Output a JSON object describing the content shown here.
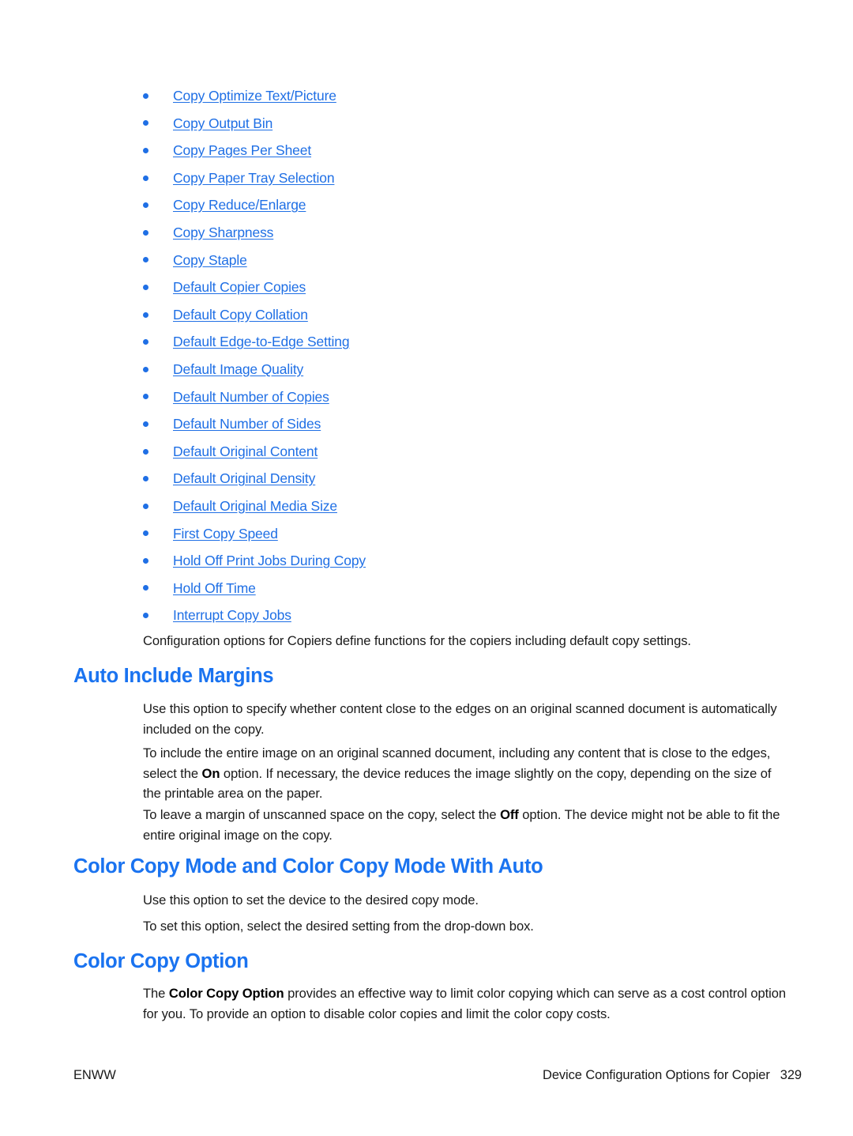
{
  "document": {
    "page_number": "329",
    "footer_left": "ENWW",
    "footer_right_title": "Device Configuration Options for Copier"
  },
  "colors": {
    "link": "#1f6fe5",
    "heading": "#1a73f0",
    "body_text": "#1a1a1a",
    "background": "#ffffff"
  },
  "link_list": [
    {
      "label": "Copy Optimize Text/Picture"
    },
    {
      "label": "Copy Output Bin"
    },
    {
      "label": "Copy Pages Per Sheet"
    },
    {
      "label": "Copy Paper Tray Selection"
    },
    {
      "label": "Copy Reduce/Enlarge"
    },
    {
      "label": "Copy Sharpness"
    },
    {
      "label": "Copy Staple"
    },
    {
      "label": "Default Copier Copies"
    },
    {
      "label": "Default Copy Collation"
    },
    {
      "label": "Default Edge-to-Edge Setting"
    },
    {
      "label": "Default Image Quality"
    },
    {
      "label": "Default Number of Copies"
    },
    {
      "label": "Default Number of Sides"
    },
    {
      "label": "Default Original Content"
    },
    {
      "label": "Default Original Density"
    },
    {
      "label": "Default Original Media Size"
    },
    {
      "label": "First Copy Speed"
    },
    {
      "label": "Hold Off Print Jobs During Copy"
    },
    {
      "label": "Hold Off Time"
    },
    {
      "label": "Interrupt Copy Jobs"
    }
  ],
  "intro_paragraph": "Configuration options for Copiers define functions for the copiers including default copy settings.",
  "sections": [
    {
      "heading": "Auto Include Margins",
      "p1": "Use this option to specify whether content close to the edges on an original scanned document is automatically included on the copy.",
      "p2_a": "To include the entire image on an original scanned document, including any content that is close to the edges, select the ",
      "p2_bold": "On",
      "p2_b": " option. If necessary, the device reduces the image slightly on the copy, depending on the size of the printable area on the paper.",
      "p3_a": "To leave a margin of unscanned space on the copy, select the ",
      "p3_bold": "Off",
      "p3_b": " option. The device might not be able to fit the entire original image on the copy."
    },
    {
      "heading": "Color Copy Mode and Color Copy Mode With Auto",
      "p1": "Use this option to set the device to the desired copy mode.",
      "p2": "To set this option, select the desired setting from the drop-down box."
    },
    {
      "heading": "Color Copy Option",
      "p1_a": "The ",
      "p1_bold": "Color Copy Option",
      "p1_b": " provides an effective way to limit color copying which can serve as a cost control option for you. To provide an option to disable color copies and limit the color copy costs."
    }
  ]
}
